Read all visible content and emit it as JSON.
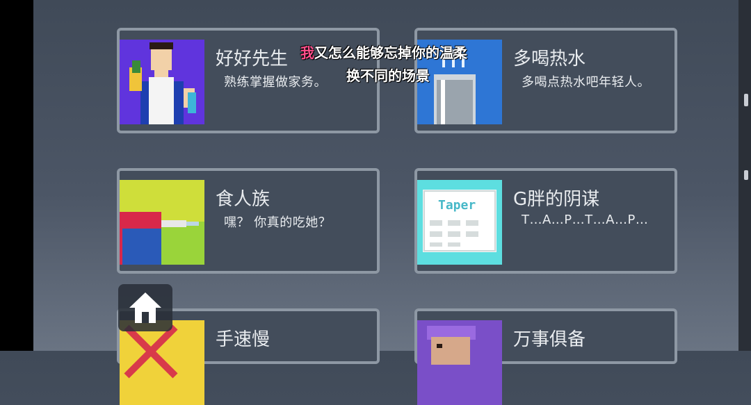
{
  "cards": [
    {
      "title": "好好先生",
      "desc": "熟练掌握做家务。"
    },
    {
      "title": "多喝热水",
      "desc": "多喝点热水吧年轻人。"
    },
    {
      "title": "食人族",
      "desc": "嘿？ 你真的吃她？"
    },
    {
      "title": "G胖的阴谋",
      "desc": "T…A…P…T…A…P…",
      "thumb_text": "Taper"
    },
    {
      "title": "手速慢",
      "desc": ""
    },
    {
      "title": "万事俱备",
      "desc": ""
    }
  ],
  "lyrics": {
    "line1_accent": "我",
    "line1_rest": "又怎么能够忘掉你的温柔",
    "line2": "换不同的场景"
  },
  "icons": {
    "home": "home-icon"
  }
}
